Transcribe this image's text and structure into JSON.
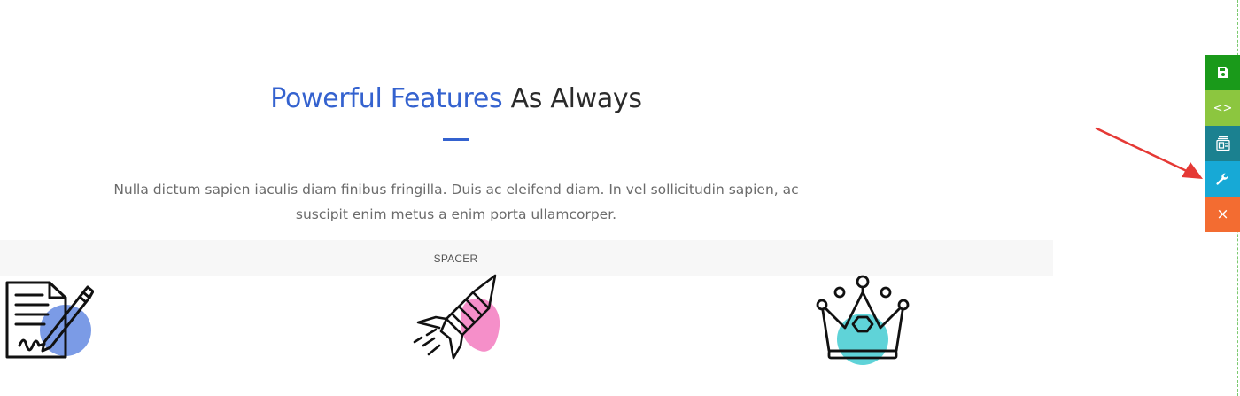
{
  "heading": {
    "accent": "Powerful Features",
    "rest": "As Always"
  },
  "description": "Nulla dictum sapien iaculis diam finibus fringilla. Duis ac eleifend diam. In vel sollicitudin sapien, ac suscipit enim metus a enim porta ullamcorper.",
  "spacer": {
    "label": "SPACER"
  },
  "features": [
    {
      "icon": "document-pen-icon",
      "blob_color": "#7b9be6"
    },
    {
      "icon": "rocket-icon",
      "blob_color": "#f58fc9"
    },
    {
      "icon": "crown-icon",
      "blob_color": "#5fd3d8"
    }
  ],
  "toolbar": [
    {
      "name": "save",
      "icon": "save-icon",
      "color": "#1a9a1a",
      "glyph": ""
    },
    {
      "name": "code",
      "icon": "code-icon",
      "color": "#8cc63f",
      "glyph": "<>"
    },
    {
      "name": "template",
      "icon": "template-icon",
      "color": "#1b8190",
      "glyph": ""
    },
    {
      "name": "settings",
      "icon": "wrench-icon",
      "color": "#17a9d6",
      "glyph": ""
    },
    {
      "name": "close",
      "icon": "close-icon",
      "color": "#f36c31",
      "glyph": "×"
    }
  ],
  "colors": {
    "accent": "#3462cf",
    "heading": "#2b2b2b",
    "body_text": "#6b6b6b",
    "annotation_arrow": "#e53935"
  }
}
